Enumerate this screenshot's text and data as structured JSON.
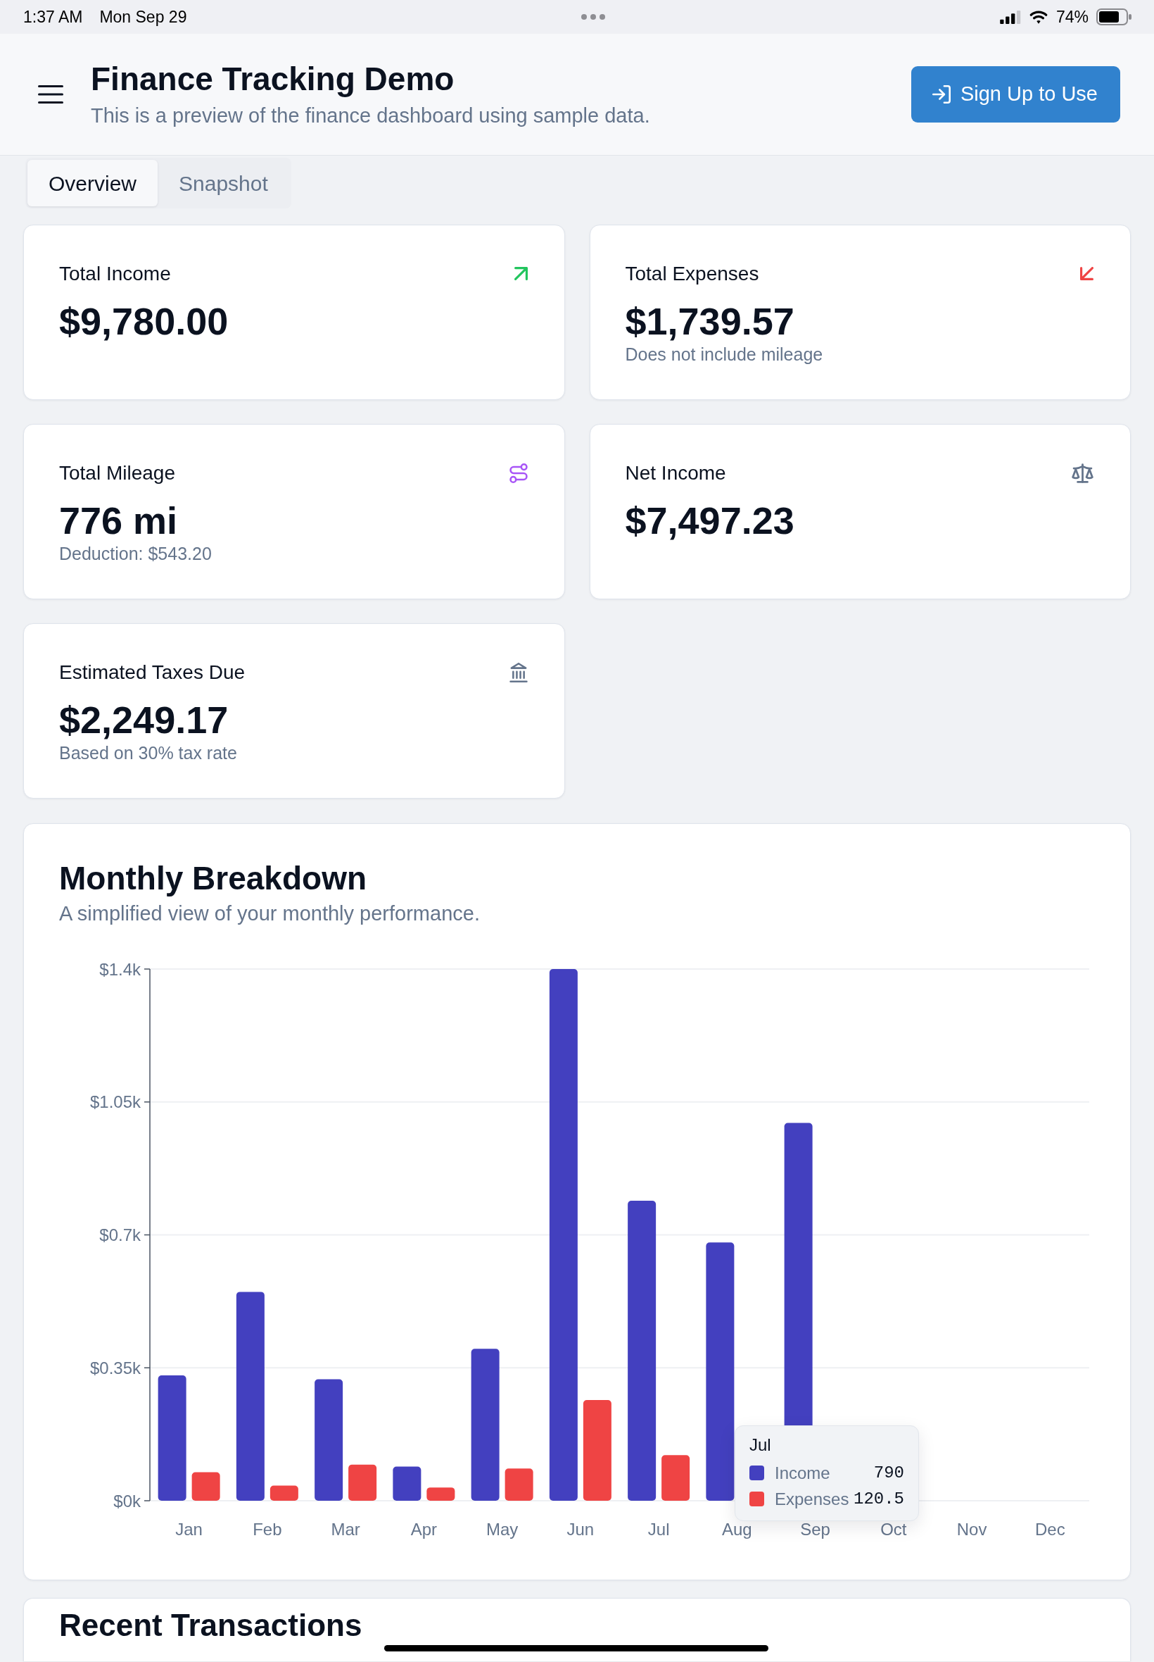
{
  "status_bar": {
    "time": "1:37 AM",
    "date": "Mon Sep 29",
    "battery": "74%"
  },
  "header": {
    "title": "Finance Tracking Demo",
    "subtitle": "This is a preview of the finance dashboard using sample data.",
    "button": "Sign Up to Use"
  },
  "tabs": [
    {
      "label": "Overview",
      "selected": true
    },
    {
      "label": "Snapshot",
      "selected": false
    }
  ],
  "stats": [
    {
      "kind": "income",
      "label": "Total Income",
      "value": "$9,780.00"
    },
    {
      "kind": "expenses",
      "label": "Total Expenses",
      "value": "$1,739.57",
      "note": "Does not include mileage"
    },
    {
      "kind": "mileage",
      "label": "Total Mileage",
      "value": "776 mi",
      "note": "Deduction: $543.20"
    },
    {
      "kind": "net",
      "label": "Net Income",
      "value": "$7,497.23"
    },
    {
      "kind": "taxes",
      "label": "Estimated Taxes Due",
      "value": "$2,249.17",
      "note": "Based on 30% tax rate"
    }
  ],
  "monthly_breakdown": {
    "title": "Monthly Breakdown",
    "subtitle": "A simplified view of your monthly performance.",
    "chart_data": {
      "type": "bar",
      "categories": [
        "Jan",
        "Feb",
        "Mar",
        "Apr",
        "May",
        "Jun",
        "Jul",
        "Aug",
        "Sep",
        "Oct",
        "Nov",
        "Dec"
      ],
      "series": [
        {
          "name": "Income",
          "color": "#4340bf",
          "values": [
            330,
            550,
            320,
            90,
            400,
            1400,
            790,
            680,
            995,
            null,
            null,
            null
          ]
        },
        {
          "name": "Expenses",
          "color": "#ef4444",
          "values": [
            75,
            40,
            95,
            35,
            85,
            265,
            120,
            null,
            null,
            null,
            null,
            null
          ]
        }
      ],
      "ylim": [
        0,
        1400
      ],
      "yticks": [
        {
          "value": 0,
          "label": "$0k"
        },
        {
          "value": 350,
          "label": "$0.35k"
        },
        {
          "value": 700,
          "label": "$0.7k"
        },
        {
          "value": 1050,
          "label": "$1.05k"
        },
        {
          "value": 1400,
          "label": "$1.4k"
        }
      ],
      "grid": true,
      "legend": {
        "title": "Jul",
        "values": [
          "790",
          "120.5"
        ]
      }
    }
  },
  "recent_transactions": {
    "title": "Recent Transactions"
  }
}
